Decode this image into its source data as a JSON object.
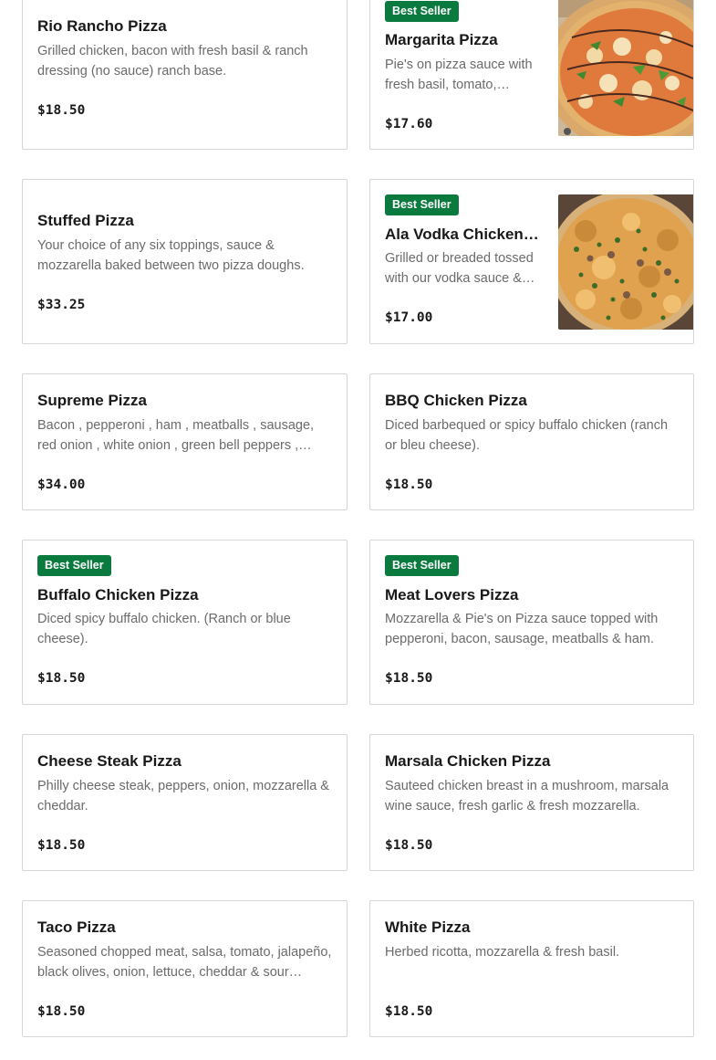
{
  "menu": {
    "items": [
      {
        "name": "Rio Rancho Pizza",
        "description": "Grilled chicken, bacon with fresh basil & ranch dressing (no sauce) ranch base.",
        "price": "$18.50",
        "badge": "",
        "has_image": false
      },
      {
        "name": "Margarita Pizza",
        "description": "Pie's on pizza sauce with fresh basil, tomato, mozzarella & parmesan.",
        "price": "$17.60",
        "badge": "Best Seller",
        "has_image": true,
        "image_alt": "margarita-pizza-photo"
      },
      {
        "name": "Stuffed Pizza",
        "description": "Your choice of any six toppings, sauce & mozzarella baked between two pizza doughs.",
        "price": "$33.25",
        "badge": "",
        "has_image": false
      },
      {
        "name": "Ala Vodka Chicken Pizza",
        "description": "Grilled or breaded tossed with our vodka sauce & mozzarella.",
        "price": "$17.00",
        "badge": "Best Seller",
        "has_image": true,
        "image_alt": "ala-vodka-chicken-pizza-photo"
      },
      {
        "name": "Supreme Pizza",
        "description": "Bacon , pepperoni , ham , meatballs , sausage, red onion , white onion , green bell peppers , banana peppers , mushrooms & black olives.",
        "price": "$34.00",
        "badge": "",
        "has_image": false
      },
      {
        "name": "BBQ Chicken Pizza",
        "description": "Diced barbequed or spicy buffalo chicken (ranch or bleu cheese).",
        "price": "$18.50",
        "badge": "",
        "has_image": false
      },
      {
        "name": "Buffalo Chicken Pizza",
        "description": "Diced spicy buffalo chicken. (Ranch or blue cheese).",
        "price": "$18.50",
        "badge": "Best Seller",
        "has_image": false
      },
      {
        "name": "Meat Lovers Pizza",
        "description": "Mozzarella & Pie's on Pizza sauce topped with pepperoni, bacon, sausage, meatballs & ham.",
        "price": "$18.50",
        "badge": "Best Seller",
        "has_image": false
      },
      {
        "name": "Cheese Steak Pizza",
        "description": "Philly cheese steak, peppers, onion, mozzarella & cheddar.",
        "price": "$18.50",
        "badge": "",
        "has_image": false
      },
      {
        "name": "Marsala Chicken Pizza",
        "description": "Sauteed chicken breast in a mushroom, marsala wine sauce, fresh garlic & fresh mozzarella.",
        "price": "$18.50",
        "badge": "",
        "has_image": false
      },
      {
        "name": "Taco Pizza",
        "description": "Seasoned chopped meat, salsa, tomato, jalapeño, black olives, onion, lettuce, cheddar & sour cream.",
        "price": "$18.50",
        "badge": "",
        "has_image": false
      },
      {
        "name": "White Pizza",
        "description": "Herbed ricotta, mozzarella & fresh basil.",
        "price": "$18.50",
        "badge": "",
        "has_image": false
      }
    ]
  },
  "colors": {
    "badge_bg": "#0a7a3e",
    "card_border": "#d6d6d6",
    "description_text": "#6b6b6b"
  }
}
